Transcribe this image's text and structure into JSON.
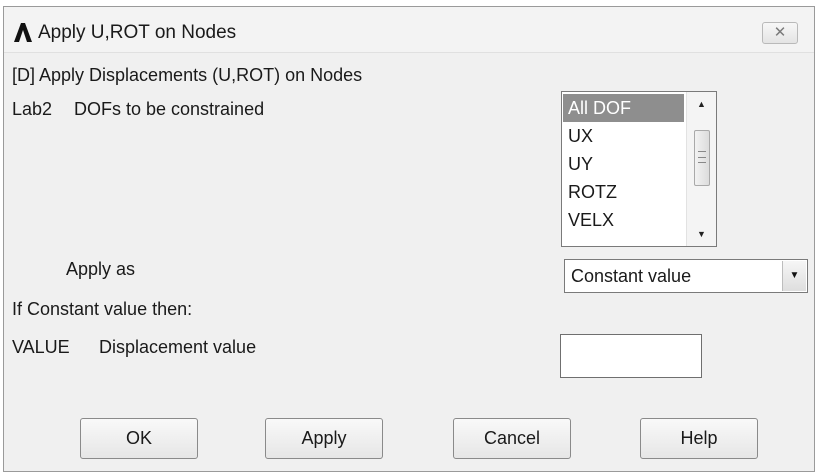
{
  "window": {
    "title": "Apply U,ROT on Nodes",
    "close_glyph": "✕",
    "app_icon": "ansys-lambda-icon"
  },
  "form": {
    "header": "[D] Apply Displacements (U,ROT) on Nodes",
    "lab2_key": "Lab2",
    "lab2_desc": "DOFs to be constrained",
    "dof_options": [
      "All DOF",
      "UX",
      "UY",
      "ROTZ",
      "VELX"
    ],
    "dof_selected": "All DOF",
    "apply_as_label": "Apply as",
    "apply_as_value": "Constant value",
    "if_constant_label": "If Constant value then:",
    "value_key": "VALUE",
    "value_desc": "Displacement value",
    "value_input": ""
  },
  "buttons": {
    "ok": "OK",
    "apply": "Apply",
    "cancel": "Cancel",
    "help": "Help"
  },
  "colors": {
    "dialog_bg": "#f0f0f0",
    "selection_bg": "#8e8e8e"
  }
}
